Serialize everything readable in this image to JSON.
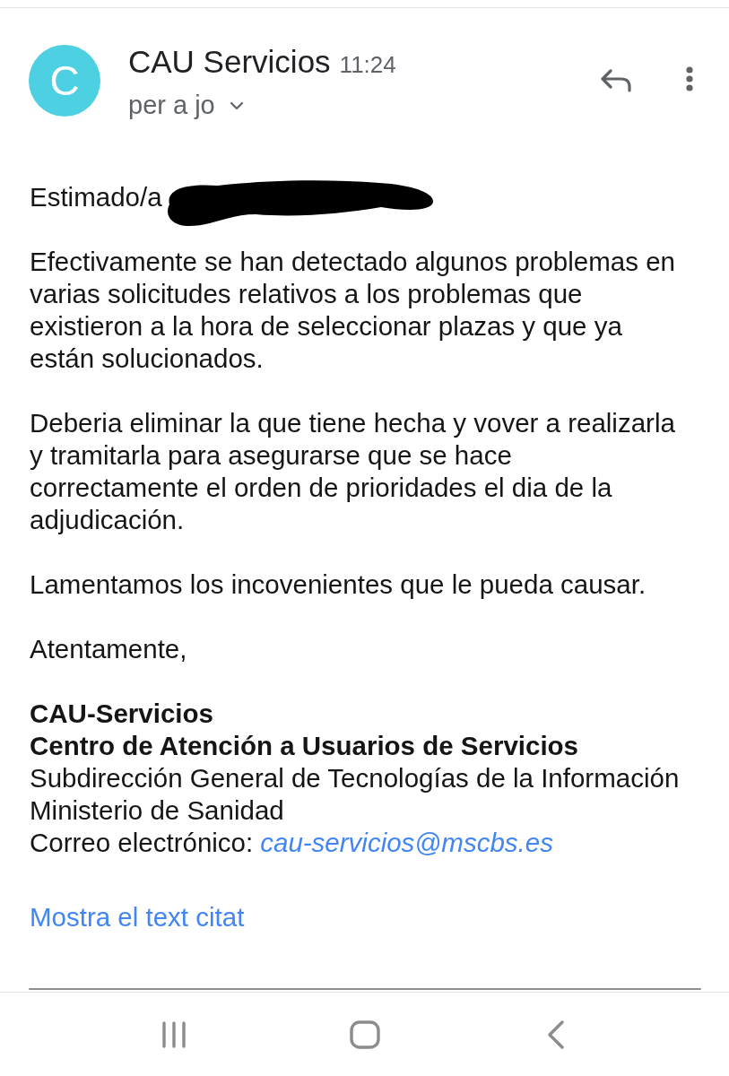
{
  "message": {
    "avatar": "C",
    "sender": "CAU Servicios",
    "time": "11:24",
    "recipients": "per a jo"
  },
  "body": {
    "greeting": {
      "text": "Estimado/a",
      "redacted": true
    },
    "paragraphs": [
      "Efectivamente se han detectado algunos problemas en varias solicitudes relativos a los problemas que existieron a la hora de seleccionar plazas y que ya están solucionados.",
      "Deberia eliminar la que tiene hecha y vover a realizarla y tramitarla para asegurarse que se hace correctamente el orden de prioridades el dia de la adjudicación.",
      "Lamentamos los incovenientes que le pueda causar.",
      "Atentamente,"
    ],
    "signature": [
      {
        "text": "CAU-Servicios",
        "bold": true
      },
      {
        "text": "Centro de Atención a Usuarios de Servicios",
        "bold": true
      },
      {
        "text": "Subdirección General de Tecnologías de la Información",
        "bold": false
      },
      {
        "text": "Ministerio de Sanidad",
        "bold": false
      },
      {
        "text": "Correo electrónico:",
        "bold": false,
        "link": "cau-servicios@mscbs.es"
      }
    ],
    "show_quoted": "Mostra el text citat"
  }
}
